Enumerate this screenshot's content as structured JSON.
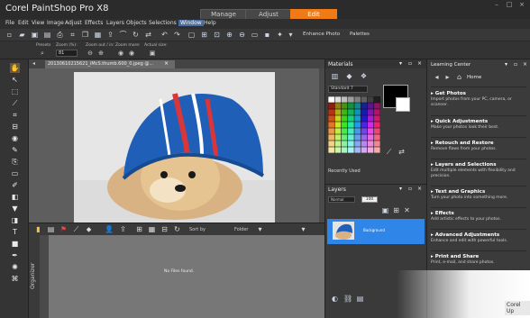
{
  "app": {
    "title": "Corel PaintShop Pro X8",
    "workspace_tabs": [
      "Manage",
      "Adjust",
      "Edit"
    ],
    "active_workspace": "Edit"
  },
  "menu": [
    "File",
    "Edit",
    "View",
    "Image",
    "Adjust",
    "Effects",
    "Layers",
    "Objects",
    "Selections",
    "Window",
    "Help"
  ],
  "toolbar": {
    "enhance_photo": "Enhance Photo",
    "palettes": "Palettes"
  },
  "tool_options": {
    "presets_label": "Presets",
    "zoom_label": "Zoom (%):",
    "zoom_value": "81",
    "zoom_out_in_label": "Zoom out / in:",
    "zoom_more_label": "Zoom more:",
    "actual_size_label": "Actual size:"
  },
  "document": {
    "tab_title": "20130610215621_iMcS.thumb.600_0.jpeg @..."
  },
  "organizer": {
    "label": "Organizer",
    "sort_by": "Sort by",
    "folder": "Folder",
    "empty_message": "No Files found."
  },
  "materials": {
    "title": "Materials",
    "swatch_set": "Standard 7",
    "recently_used": "Recently Used"
  },
  "layers": {
    "title": "Layers",
    "blend_mode": "Normal",
    "opacity": "100",
    "layer_name": "Background"
  },
  "learning_center": {
    "title": "Learning Center",
    "home": "Home",
    "items": [
      {
        "title": "Get Photos",
        "desc": "Import photos from your PC, camera, or scanner."
      },
      {
        "title": "Quick Adjustments",
        "desc": "Make your photos look their best."
      },
      {
        "title": "Retouch and Restore",
        "desc": "Remove flaws from your photos."
      },
      {
        "title": "Layers and Selections",
        "desc": "Edit multiple elements with flexibility and precision."
      },
      {
        "title": "Text and Graphics",
        "desc": "Turn your photo into something more."
      },
      {
        "title": "Effects",
        "desc": "Add artistic effects to your photos."
      },
      {
        "title": "Advanced Adjustments",
        "desc": "Enhance and edit with powerful tools."
      },
      {
        "title": "Print and Share",
        "desc": "Print, e-mail, and share photos."
      }
    ]
  },
  "tooltip": "Corel Up",
  "colors": {
    "accent": "#f07a16",
    "selection": "#2f86e8"
  }
}
